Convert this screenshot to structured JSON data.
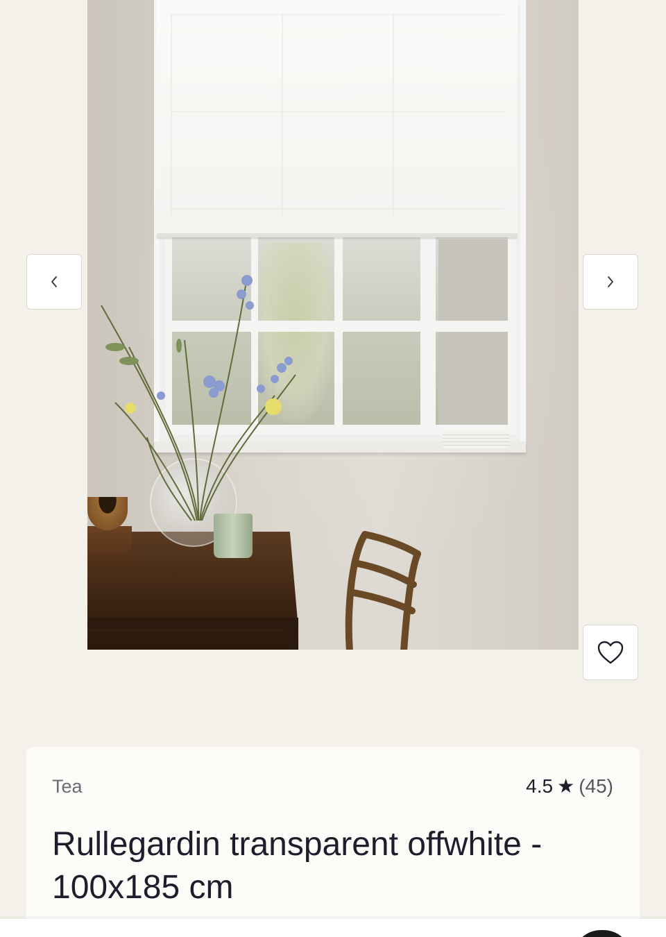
{
  "gallery": {
    "image_alt": "Rullegardin transparent offwhite i vindu",
    "prev_icon": "chevron-left-icon",
    "next_icon": "chevron-right-icon",
    "favorite_icon": "heart-outline-icon"
  },
  "product": {
    "brand": "Tea",
    "rating": "4.5",
    "rating_star": "★",
    "rating_count": "(45)",
    "title": "Rullegardin transparent offwhite - 100x185 cm"
  },
  "colors": {
    "background": "#f4f1eb",
    "card": "#fcfbf8",
    "text": "#1e1d2b",
    "muted": "#6c6a72"
  }
}
